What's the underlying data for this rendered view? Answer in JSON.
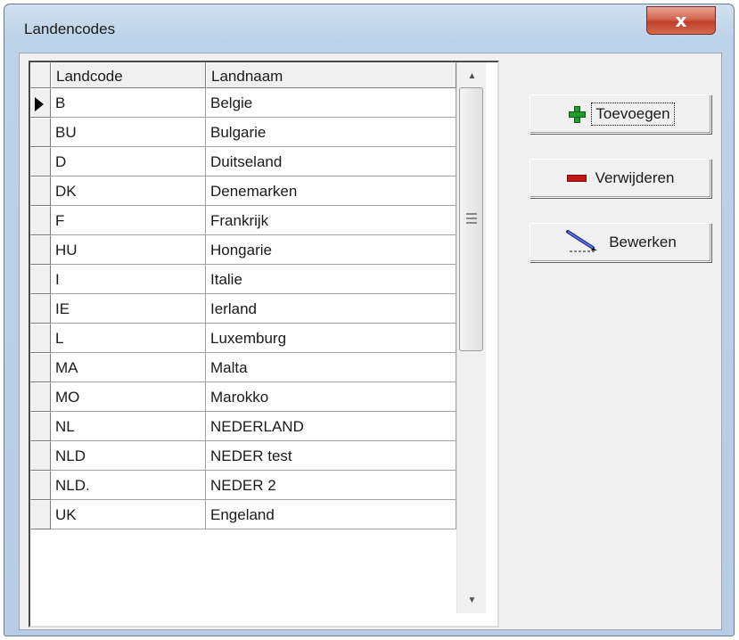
{
  "window": {
    "title": "Landencodes",
    "close_label": "x"
  },
  "grid": {
    "columns": [
      "Landcode",
      "Landnaam"
    ],
    "selected_row": 0,
    "rows": [
      {
        "code": "B",
        "name": "Belgie"
      },
      {
        "code": "BU",
        "name": "Bulgarie"
      },
      {
        "code": "D",
        "name": "Duitseland"
      },
      {
        "code": "DK",
        "name": "Denemarken"
      },
      {
        "code": "F",
        "name": "Frankrijk"
      },
      {
        "code": "HU",
        "name": "Hongarie"
      },
      {
        "code": "I",
        "name": "Italie"
      },
      {
        "code": "IE",
        "name": "Ierland"
      },
      {
        "code": "L",
        "name": "Luxemburg"
      },
      {
        "code": "MA",
        "name": "Malta"
      },
      {
        "code": "MO",
        "name": "Marokko"
      },
      {
        "code": "NL",
        "name": "NEDERLAND"
      },
      {
        "code": "NLD",
        "name": "NEDER test"
      },
      {
        "code": "NLD.",
        "name": "NEDER 2"
      },
      {
        "code": "UK",
        "name": "Engeland"
      }
    ]
  },
  "buttons": {
    "add": "Toevoegen",
    "delete": "Verwijderen",
    "edit": "Bewerken"
  },
  "icons": {
    "add": "plus-icon",
    "delete": "minus-icon",
    "edit": "pencil-icon",
    "close": "close-icon"
  },
  "colors": {
    "plus": "#1e9a2e",
    "minus": "#c01818",
    "pencil": "#1a2a9a",
    "close": "#c0402a"
  }
}
